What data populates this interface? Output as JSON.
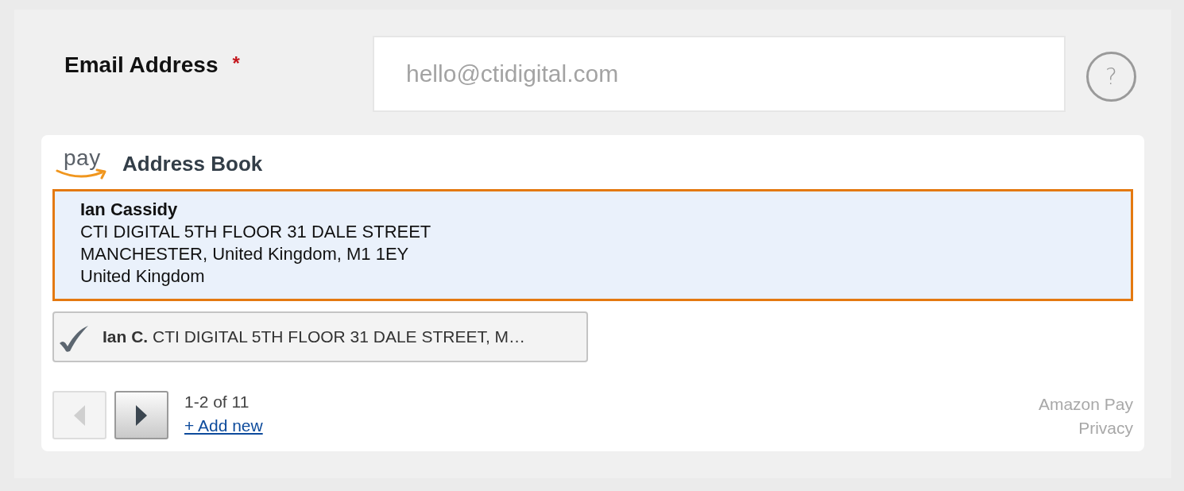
{
  "email": {
    "label": "Email Address",
    "required_mark": "*",
    "placeholder": "hello@ctidigital.com",
    "help": "?"
  },
  "address_book": {
    "logo_text": "pay",
    "title": "Address Book",
    "addresses": [
      {
        "selected": true,
        "name": "Ian Cassidy",
        "lines": [
          "CTI DIGITAL 5TH FLOOR 31 DALE STREET",
          "MANCHESTER, United Kingdom, M1 1EY",
          "United Kingdom"
        ]
      },
      {
        "selected": false,
        "summary": "**Ian C.** CTI DIGITAL 5TH FLOOR 31 DALE STREET, M…"
      }
    ],
    "pagination": {
      "previous_disabled": true,
      "next_disabled": false,
      "range": "1-2 of 11",
      "add_link": "+ Add new"
    },
    "footer_links": [
      "Amazon Pay",
      "Privacy"
    ]
  }
}
